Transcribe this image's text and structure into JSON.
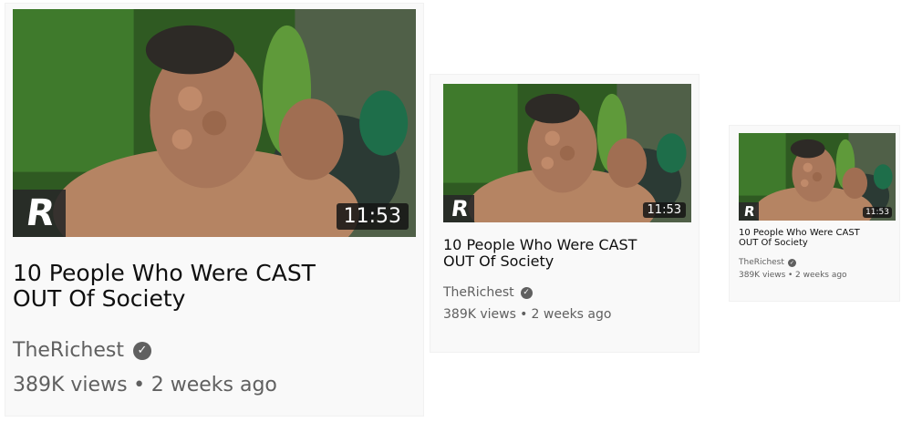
{
  "thumbnail": {
    "logo_text": "R",
    "duration": "11:53",
    "alt": "thumbnail"
  },
  "video": {
    "title_line1": "10 People Who Were CAST",
    "title_line2": "OUT Of Society",
    "channel": "TheRichest",
    "verified_icon": "verified-check-icon",
    "views": "389K views",
    "separator": "•",
    "age": "2 weeks ago"
  }
}
